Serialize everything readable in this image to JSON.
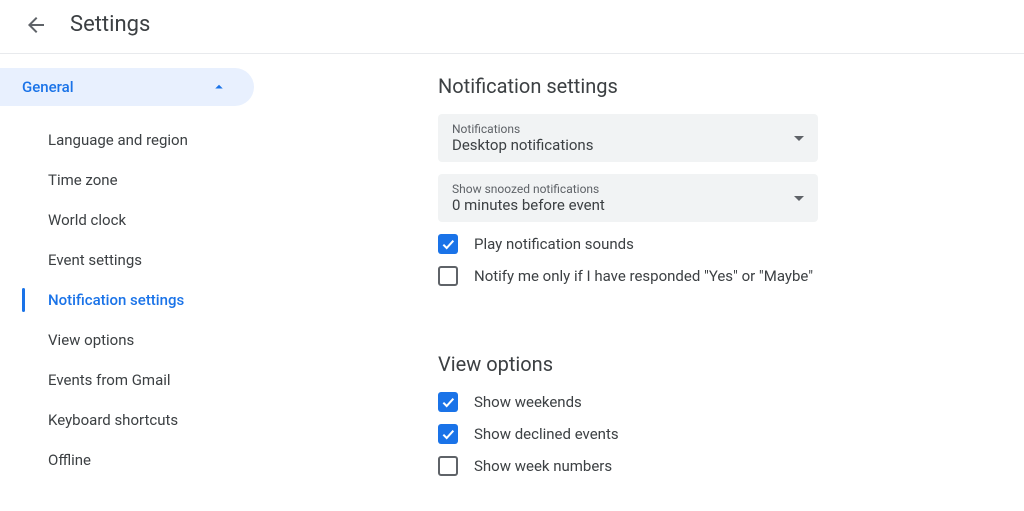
{
  "header": {
    "title": "Settings"
  },
  "sidebar": {
    "section_label": "General",
    "items": [
      {
        "label": "Language and region"
      },
      {
        "label": "Time zone"
      },
      {
        "label": "World clock"
      },
      {
        "label": "Event settings"
      },
      {
        "label": "Notification settings"
      },
      {
        "label": "View options"
      },
      {
        "label": "Events from Gmail"
      },
      {
        "label": "Keyboard shortcuts"
      },
      {
        "label": "Offline"
      }
    ],
    "active_index": 4
  },
  "main": {
    "notification_settings": {
      "title": "Notification settings",
      "dropdowns": [
        {
          "label": "Notifications",
          "value": "Desktop notifications"
        },
        {
          "label": "Show snoozed notifications",
          "value": "0 minutes before event"
        }
      ],
      "checkboxes": [
        {
          "label": "Play notification sounds",
          "checked": true
        },
        {
          "label": "Notify me only if I have responded \"Yes\" or \"Maybe\"",
          "checked": false
        }
      ]
    },
    "view_options": {
      "title": "View options",
      "checkboxes": [
        {
          "label": "Show weekends",
          "checked": true
        },
        {
          "label": "Show declined events",
          "checked": true
        },
        {
          "label": "Show week numbers",
          "checked": false
        }
      ]
    }
  }
}
